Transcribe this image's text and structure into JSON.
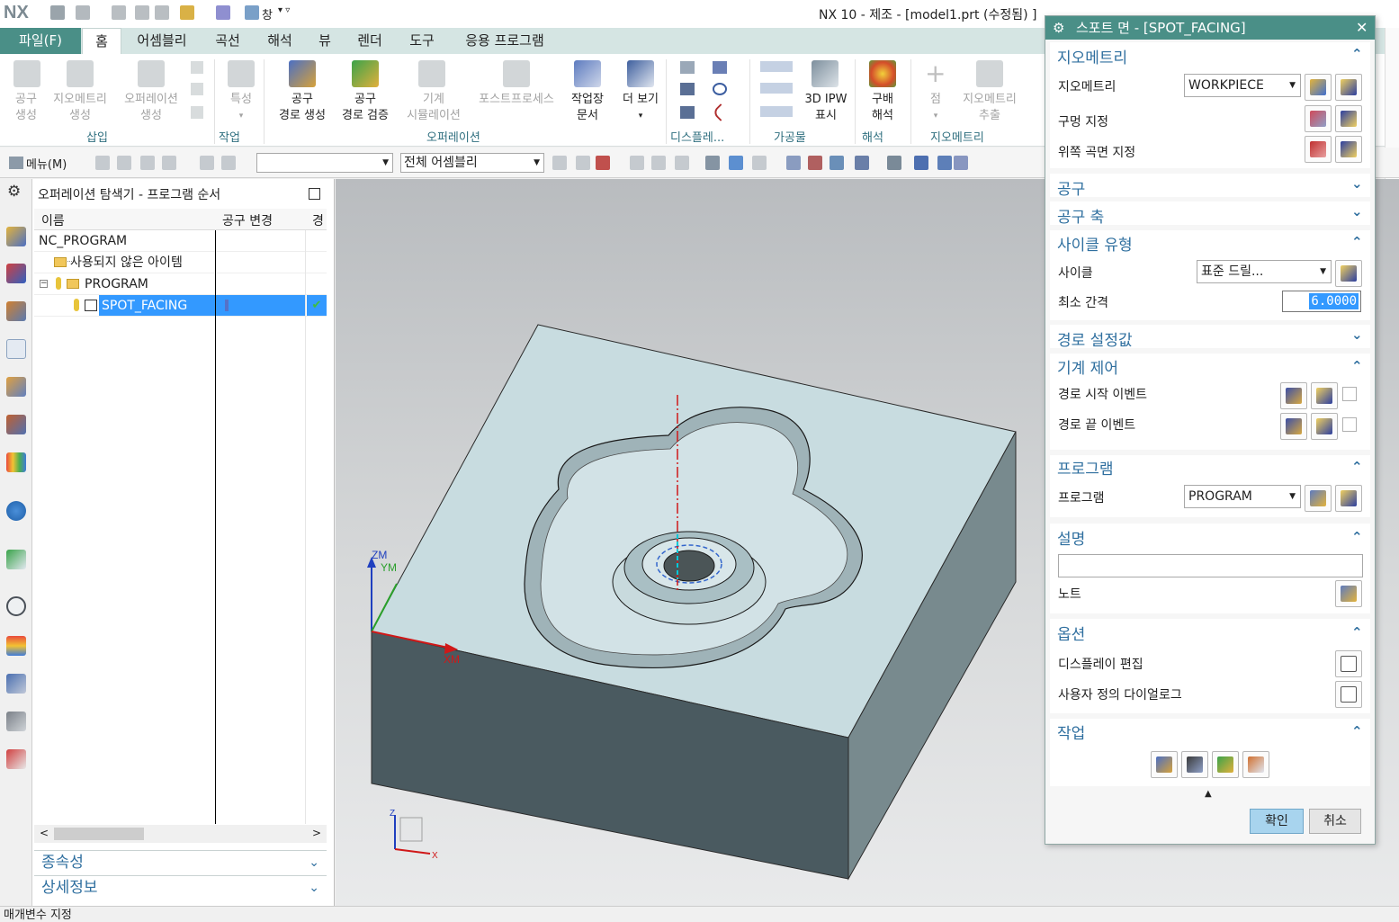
{
  "titlebar": {
    "logo": "NX",
    "window_menu": "창",
    "title": "NX 10 - 제조 - [model1.prt (수정됨) ]"
  },
  "menu_tabs": [
    "파일(F)",
    "홈",
    "어셈블리",
    "곡선",
    "해석",
    "뷰",
    "렌더",
    "도구",
    "응용 프로그램"
  ],
  "ribbon": {
    "buttons": [
      {
        "line1": "공구",
        "line2": "생성",
        "enabled": false
      },
      {
        "line1": "지오메트리",
        "line2": "생성",
        "enabled": false
      },
      {
        "line1": "오퍼레이션",
        "line2": "생성",
        "enabled": false
      },
      {
        "line1": "특성",
        "line2": "",
        "enabled": false
      },
      {
        "line1": "공구",
        "line2": "경로 생성",
        "enabled": true
      },
      {
        "line1": "공구",
        "line2": "경로 검증",
        "enabled": true
      },
      {
        "line1": "기계",
        "line2": "시뮬레이션",
        "enabled": false
      },
      {
        "line1": "포스트프로세스",
        "line2": "",
        "enabled": false
      },
      {
        "line1": "작업장",
        "line2": "문서",
        "enabled": true
      },
      {
        "line1": "더 보기",
        "line2": "",
        "enabled": true
      },
      {
        "line1": "3D IPW",
        "line2": "표시",
        "enabled": true
      },
      {
        "line1": "구배",
        "line2": "해석",
        "enabled": true
      },
      {
        "line1": "점",
        "line2": "",
        "enabled": false
      },
      {
        "line1": "지오메트리",
        "line2": "추출",
        "enabled": false
      }
    ],
    "groups": [
      "삽입",
      "작업",
      "오퍼레이션",
      "디스플레...",
      "가공물",
      "해석",
      "지오메트리"
    ]
  },
  "toolbar2": {
    "menu_label": "메뉴(M)",
    "filter_combo": "",
    "scope_combo": "전체 어셈블리"
  },
  "navigator": {
    "title": "오퍼레이션 탐색기 - 프로그램 순서",
    "columns": [
      "이름",
      "공구 변경",
      "경"
    ],
    "rows": [
      {
        "name": "NC_PROGRAM"
      },
      {
        "name": "사용되지 않은 아이템"
      },
      {
        "name": "PROGRAM"
      },
      {
        "name": "SPOT_FACING"
      }
    ],
    "sections": [
      "종속성",
      "상세정보"
    ]
  },
  "viewport": {
    "axis_labels": {
      "zm": "ZM",
      "ym": "YM",
      "xm": "XM"
    },
    "triad_labels": {
      "z": "Z",
      "x": "X"
    }
  },
  "dialog": {
    "title": "스포트 면 - [SPOT_FACING]",
    "geometry": {
      "header": "지오메트리",
      "geometry_label": "지오메트리",
      "geometry_value": "WORKPIECE",
      "hole_label": "구멍 지정",
      "top_surface_label": "위쪽 곡면 지정"
    },
    "tool_header": "공구",
    "tool_axis_header": "공구 축",
    "cycle": {
      "header": "사이클 유형",
      "cycle_label": "사이클",
      "cycle_value": "표준 드릴...",
      "min_clearance_label": "최소 간격",
      "min_clearance_value": "6.0000"
    },
    "path_settings_header": "경로 설정값",
    "machine_control": {
      "header": "기계 제어",
      "start_event": "경로 시작 이벤트",
      "end_event": "경로 끝 이벤트"
    },
    "program": {
      "header": "프로그램",
      "program_label": "프로그램",
      "program_value": "PROGRAM"
    },
    "description": {
      "header": "설명",
      "text_value": "",
      "note_label": "노트"
    },
    "options": {
      "header": "옵션",
      "display_edit": "디스플레이 편집",
      "custom_dialog": "사용자 정의 다이얼로그"
    },
    "actions_header": "작업",
    "ok": "확인",
    "cancel": "취소"
  },
  "status": {
    "text": "매개변수 지정"
  },
  "colors": {
    "accent": "#4a8f87",
    "selection": "#3399ff",
    "section_header": "#2f6f9f",
    "part_top": "#c8dce0",
    "part_front": "#4a5a60",
    "part_side": "#788a8e"
  }
}
